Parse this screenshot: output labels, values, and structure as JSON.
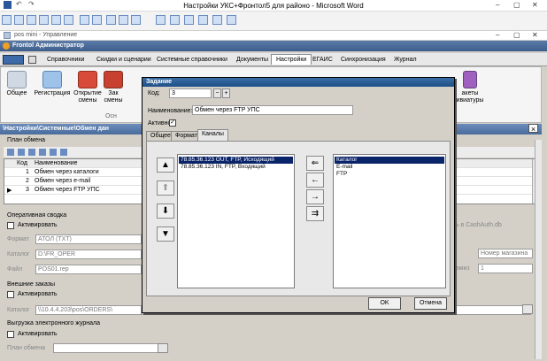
{
  "word": {
    "title": "Настройки УКС+Фронтол5 для районо - Microsoft Word",
    "minimize": "–",
    "maximize": "▢",
    "close": "✕"
  },
  "posmini": {
    "title": "pos mini - Управление"
  },
  "admin": {
    "title": "Frontol Администратор",
    "menu": [
      "Справочники",
      "Скидки и сценарии",
      "Системные справочники",
      "Документы",
      "Настройки",
      "ЕГАИС",
      "Синхронизация",
      "Журнал"
    ],
    "active_menu": "Настройки",
    "ribbon": [
      {
        "label": "Общее",
        "icon": "gear-icon"
      },
      {
        "label": "Регистрация",
        "icon": "registration-icon"
      },
      {
        "label": "Открытие смены",
        "icon": "shift-open-icon"
      },
      {
        "label": "Зак смены",
        "icon": "shift-close-icon"
      }
    ],
    "ribbon_group": "Осн",
    "ribbon_right_label": "акеты ивиатуры",
    "breadcrumb": "\\Настройки\\Системные\\Обмен дан"
  },
  "plan": {
    "section": "План обмена",
    "columns": [
      "Код",
      "Наименование"
    ],
    "rows": [
      {
        "code": "1",
        "name": "Обмен через каталоги"
      },
      {
        "code": "2",
        "name": "Обмен через e-mail"
      },
      {
        "code": "3",
        "name": "Обмен через FTP УПС"
      }
    ]
  },
  "oper": {
    "section": "Оперативная сводка",
    "activate": "Активировать",
    "format_label": "Формат",
    "format_value": "АТОЛ (TXT)",
    "catalog_label": "Каталог",
    "catalog_value": "D:\\FR_OPER",
    "file_label": "Файл",
    "file_value": "POS01.rep",
    "right_text": "ь в CashAuth.db",
    "nomer_value": "Номер магазина",
    "mag_label": "вмиз",
    "mag_value": "1"
  },
  "ext": {
    "section": "Внешние заказы",
    "activate": "Активировать",
    "catalog_label": "Каталог",
    "catalog_value": "\\\\10.4.4.203\\pos\\ORDERS\\"
  },
  "ejournal": {
    "section": "Выгрузка электронного журнала",
    "activate": "Активировать",
    "plan_label": "План обмена"
  },
  "dialog": {
    "title": "Задание",
    "code_label": "Код:",
    "code_value": "3",
    "name_label": "Наименование:",
    "name_value": "Обмен через FTP УПС",
    "active_label": "Активное:",
    "active_checked": "✓",
    "tabs": [
      "Общее",
      "Формат",
      "Каналы"
    ],
    "active_tab": "Каналы",
    "left_list": [
      "78.85.36.123 OUT, FTP, Исходящий",
      "78.85.36.123 IN, FTP, Входящий"
    ],
    "right_list": [
      "Каталог",
      "E-mail",
      "FTP"
    ],
    "ok": "OK",
    "cancel": "Отмена"
  }
}
